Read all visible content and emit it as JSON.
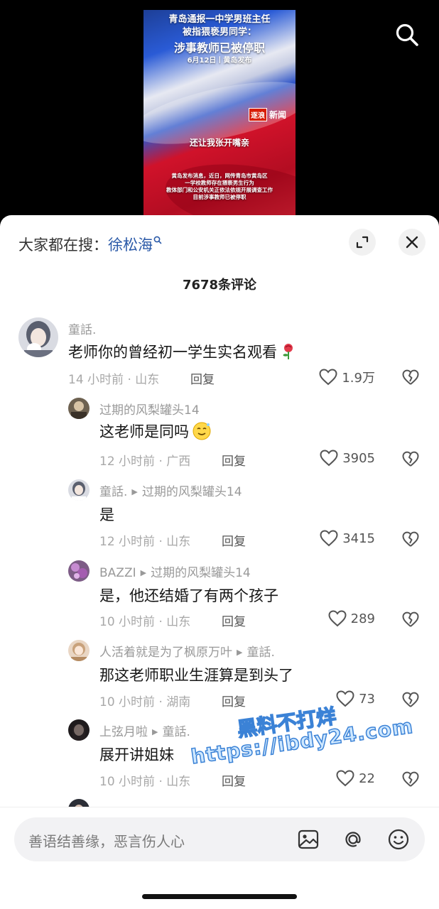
{
  "video": {
    "headline_line1": "青岛通报一中学男班主任",
    "headline_line2": "被指猥亵男同学：",
    "headline_line3": "涉事教师已被停职",
    "date_line": "6月12日丨黄岛发布",
    "logo_box": "逐浪",
    "logo_text": "新闻",
    "caption": "还让我张开嘴亲",
    "body_line1": "黄岛发布消息，近日，网传青岛市黄岛区",
    "body_line2": "一学校教师存在猥亵男生行为",
    "body_line3": "教体部门和公安机关正依法依规开展调查工作",
    "body_line4": "目前涉事教师已被停职"
  },
  "sheet": {
    "trend_prefix": "大家都在搜：",
    "trend_keyword": "徐松海",
    "comment_count": "7678条评论"
  },
  "comments": [
    {
      "user": "童話.",
      "text": "老师你的曾经初一学生实名观看",
      "time_loc": "14 小时前 · 山东",
      "reply": "回复",
      "likes": "1.9万"
    },
    {
      "user": "过期的风梨罐头14",
      "reply_to": "",
      "text": "这老师是同吗",
      "time_loc": "12 小时前 · 广西",
      "reply": "回复",
      "likes": "3905"
    },
    {
      "user": "童話.",
      "reply_to": "过期的风梨罐头14",
      "text": "是",
      "time_loc": "12 小时前 · 山东",
      "reply": "回复",
      "likes": "3415"
    },
    {
      "user": "BAZZI",
      "reply_to": "过期的风梨罐头14",
      "text": "是，他还结婚了有两个孩子",
      "time_loc": "10 小时前 · 山东",
      "reply": "回复",
      "likes": "289"
    },
    {
      "user": "人活着就是为了枫原万叶",
      "reply_to": "童話.",
      "text": "那这老师职业生涯算是到头了",
      "time_loc": "10 小时前 · 湖南",
      "reply": "回复",
      "likes": "73"
    },
    {
      "user": "上弦月啦",
      "reply_to": "童話.",
      "text": "展开讲姐妹",
      "time_loc": "10 小时前 · 山东",
      "reply": "回复",
      "likes": "22"
    }
  ],
  "input": {
    "placeholder": "善语结善缘，恶言伤人心"
  },
  "watermark": {
    "line1": "黑料不打烊",
    "line2": "https://ibdy24.com"
  },
  "colors": {
    "keyword": "#2b5aa8",
    "muted": "#999999",
    "watermark_fill": "#cfe8ff",
    "watermark_stroke": "#3b82d6"
  },
  "icons": [
    "search-icon",
    "magnifier-small-icon",
    "expand-icon",
    "close-icon",
    "heart-icon",
    "broken-heart-icon",
    "rose-emoji-icon",
    "smirk-emoji-icon",
    "image-icon",
    "at-icon",
    "emoji-icon"
  ]
}
